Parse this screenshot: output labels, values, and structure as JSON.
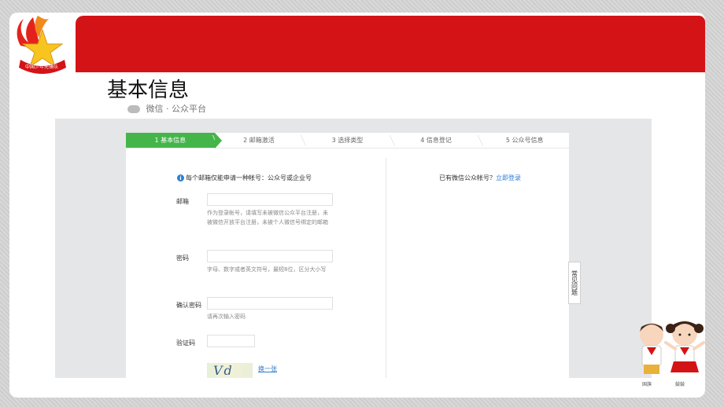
{
  "slide": {
    "title": "基本信息",
    "logo_text": "中国少年先锋队"
  },
  "wechat_header": {
    "text": "微信 · 公众平台"
  },
  "steps": [
    {
      "label": "1 基本信息",
      "active": true
    },
    {
      "label": "2 邮箱激活",
      "active": false
    },
    {
      "label": "3 选择类型",
      "active": false
    },
    {
      "label": "4 信息登记",
      "active": false
    },
    {
      "label": "5 公众号信息",
      "active": false
    }
  ],
  "notice": {
    "text": "每个邮箱仅能申请一种帐号：公众号或企业号"
  },
  "has_account": {
    "text": "已有微信公众帐号？",
    "link": "立即登录"
  },
  "form": {
    "email": {
      "label": "邮箱",
      "value": "",
      "hint": "作为登录帐号，请填写未被微信公众平台注册，未被微信开放平台注册，未被个人微信号绑定的邮箱"
    },
    "password": {
      "label": "密码",
      "value": "",
      "hint": "字母、数字或者英文符号，最短8位，区分大小写"
    },
    "confirm_password": {
      "label": "确认密码",
      "value": "",
      "hint": "请再次输入密码"
    },
    "captcha": {
      "label": "验证码",
      "value": "",
      "image_text": "Vd",
      "refresh": "换一张"
    }
  },
  "faq_tab": {
    "label": "常见问题"
  },
  "kids": {
    "left_label": "国旗",
    "right_label": "鼓鼓"
  },
  "colors": {
    "brand_red": "#d41317",
    "step_green": "#44b549",
    "link_blue": "#2e7dd1"
  }
}
